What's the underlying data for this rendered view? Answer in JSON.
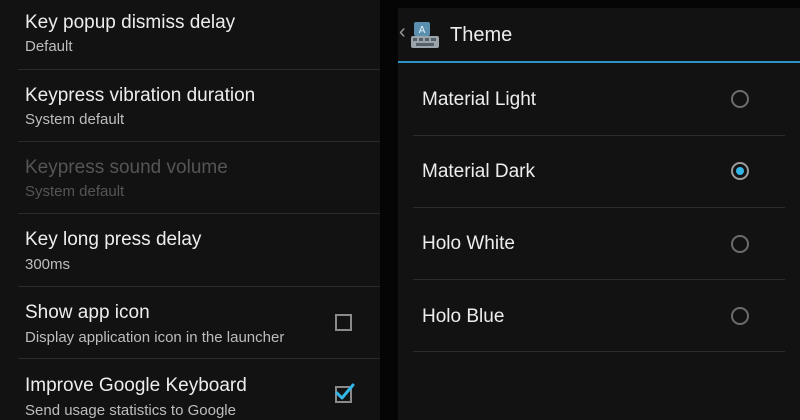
{
  "settings": {
    "items": [
      {
        "title": "Key popup dismiss delay",
        "summary": "Default",
        "enabled": true
      },
      {
        "title": "Keypress vibration duration",
        "summary": "System default",
        "enabled": true
      },
      {
        "title": "Keypress sound volume",
        "summary": "System default",
        "enabled": false
      },
      {
        "title": "Key long press delay",
        "summary": "300ms",
        "enabled": true
      },
      {
        "title": "Show app icon",
        "summary": "Display application icon in the launcher",
        "enabled": true,
        "checked": false
      },
      {
        "title": "Improve Google Keyboard",
        "summary": "Send usage statistics to Google",
        "enabled": true,
        "checked": true
      }
    ]
  },
  "theme_dialog": {
    "title": "Theme",
    "options": [
      "Material Light",
      "Material Dark",
      "Holo White",
      "Holo Blue"
    ],
    "selected": "Material Dark"
  },
  "colors": {
    "accent": "#2e94c8",
    "radio_selected": "#33b5e5",
    "checkmark": "#33b5e5"
  },
  "icons": {
    "back": "chevron-left-icon",
    "app": "keyboard-app-icon",
    "checkbox_checked": "check-icon"
  }
}
